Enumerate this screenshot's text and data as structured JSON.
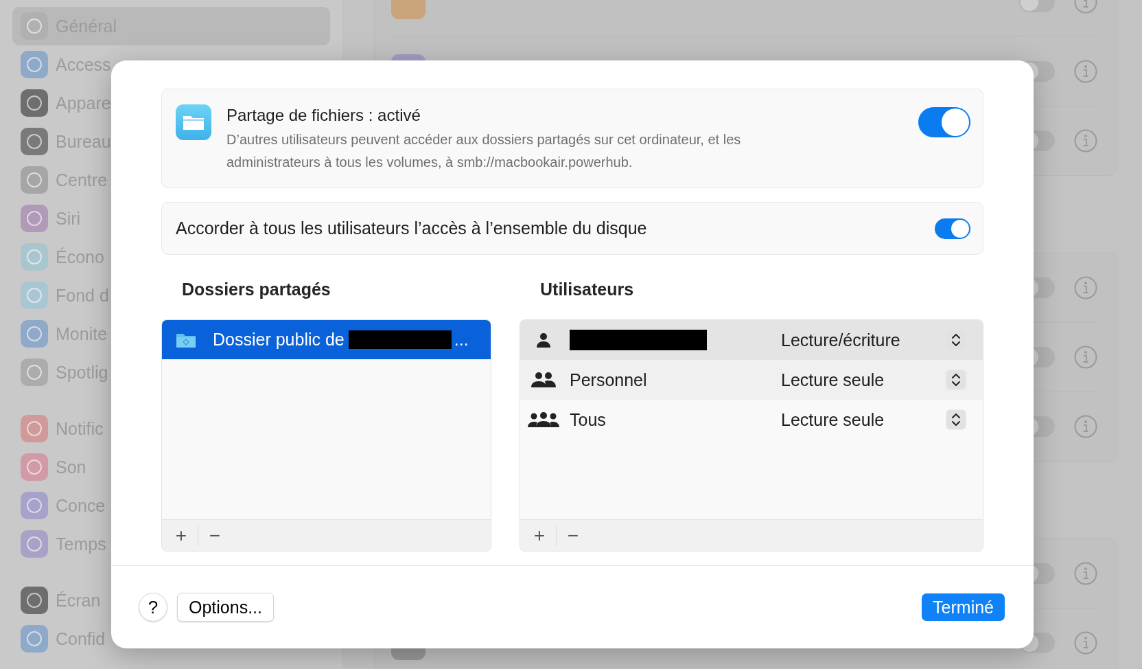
{
  "sidebar": {
    "groups": [
      {
        "items": [
          {
            "label": "Général",
            "selected": true,
            "color": "#b0b0b0"
          },
          {
            "label": "Access",
            "selected": false,
            "color": "#8fa9c9"
          },
          {
            "label": "Appare",
            "selected": false,
            "color": "#6e6e6e"
          },
          {
            "label": "Bureau",
            "selected": false,
            "color": "#7a7a7a"
          },
          {
            "label": "Centre",
            "selected": false,
            "color": "#a6a6a6"
          },
          {
            "label": "Siri",
            "selected": false,
            "color": "#b09ab8"
          },
          {
            "label": "Écono",
            "selected": false,
            "color": "#a9c6cf"
          },
          {
            "label": "Fond d",
            "selected": false,
            "color": "#a9c6d4"
          },
          {
            "label": "Monite",
            "selected": false,
            "color": "#8fa9c9"
          },
          {
            "label": "Spotlig",
            "selected": false,
            "color": "#acacac"
          }
        ]
      },
      {
        "items": [
          {
            "label": "Notific",
            "selected": false,
            "color": "#d19a9a"
          },
          {
            "label": "Son",
            "selected": false,
            "color": "#d19aa6"
          },
          {
            "label": "Conce",
            "selected": false,
            "color": "#a6a2c9"
          },
          {
            "label": "Temps",
            "selected": false,
            "color": "#aaa2c6"
          }
        ]
      },
      {
        "items": [
          {
            "label": "Écran",
            "selected": false,
            "color": "#6e6e6e"
          },
          {
            "label": "Confid",
            "selected": false,
            "color": "#8fa9c9"
          }
        ]
      }
    ]
  },
  "services": {
    "groups": [
      {
        "rows": [
          {
            "on": false,
            "color": "#c9a47a"
          },
          {
            "on": false,
            "color": "#a39cc4"
          },
          {
            "on": false
          }
        ]
      },
      {
        "rows": [
          {
            "on": false
          },
          {
            "on": false
          },
          {
            "on": false
          }
        ]
      },
      {
        "rows": [
          {
            "on": false
          },
          {
            "on": false,
            "color": "#9a9a9a"
          }
        ]
      }
    ]
  },
  "sheet": {
    "sharing": {
      "title": "Partage de fichiers : activé",
      "description": "D’autres utilisateurs peuvent accéder aux dossiers partagés sur cet ordinateur, et les administrateurs à tous les volumes, à smb://macbookair.powerhub.",
      "on": true
    },
    "full_disk": {
      "label": "Accorder à tous les utilisateurs l’accès à l’ensemble du disque",
      "on": true
    },
    "shared_folders": {
      "heading": "Dossiers partagés",
      "items": [
        {
          "label": "Dossier public de",
          "redacted": true,
          "suffix": "...",
          "selected": true
        }
      ],
      "add": "+",
      "remove": "−"
    },
    "users": {
      "heading": "Utilisateurs",
      "rows": [
        {
          "kind": "user",
          "redacted": true,
          "permission": "Lecture/écriture",
          "selected": true
        },
        {
          "kind": "group",
          "name": "Personnel",
          "permission": "Lecture seule",
          "selected": false
        },
        {
          "kind": "everyone",
          "name": "Tous",
          "permission": "Lecture seule",
          "selected": false
        }
      ],
      "add": "+",
      "remove": "−"
    },
    "help": "?",
    "options": "Options...",
    "done": "Terminé"
  }
}
